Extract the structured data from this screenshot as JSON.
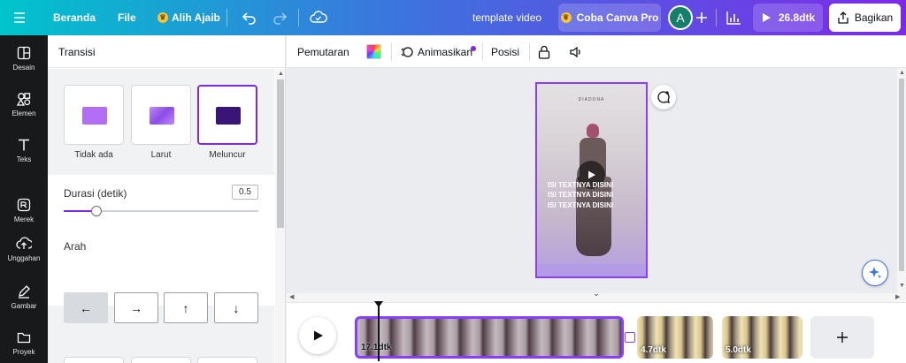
{
  "topbar": {
    "menu_icon": "hamburger-icon",
    "home": "Beranda",
    "file": "File",
    "promo": "Alih Ajaib",
    "title": "template video",
    "try_pro": "Coba Canva Pro",
    "avatar_letter": "A",
    "duration": "26.8dtk",
    "share": "Bagikan"
  },
  "rail": [
    {
      "label": "Desain",
      "icon": "layout-icon"
    },
    {
      "label": "Elemen",
      "icon": "shapes-icon"
    },
    {
      "label": "Teks",
      "icon": "text-icon"
    },
    {
      "label": "Merek",
      "icon": "brand-icon"
    },
    {
      "label": "Unggahan",
      "icon": "upload-icon"
    },
    {
      "label": "Gambar",
      "icon": "draw-icon"
    },
    {
      "label": "Proyek",
      "icon": "folder-icon"
    }
  ],
  "panel": {
    "title": "Transisi",
    "transitions": [
      {
        "label": "Tidak ada",
        "color": "#b36ef6"
      },
      {
        "label": "Larut",
        "color": "#9b5cf0"
      },
      {
        "label": "Meluncur",
        "color": "#3a1577"
      }
    ],
    "duration_label": "Durasi (detik)",
    "duration_value": "0.5",
    "duration_fraction": 0.17,
    "direction_label": "Arah",
    "directions": [
      "←",
      "→",
      "↑",
      "↓"
    ]
  },
  "toolbar": {
    "playback": "Pemutaran",
    "animate": "Animasikan",
    "position": "Posisi"
  },
  "design": {
    "brand": "DIADONA",
    "lines": [
      "ISI TEXTNYA DISINI",
      "ISI TEXTNYA DISINI",
      "ISI TEXTNYA DISINI"
    ]
  },
  "timeline": {
    "clips": [
      {
        "label": "17.1dtk"
      },
      {
        "label": "4.7dtk"
      },
      {
        "label": "5.0dtk"
      }
    ]
  },
  "colors": {
    "accent": "#7d2ae8",
    "selected_border": "#8b3dff"
  }
}
